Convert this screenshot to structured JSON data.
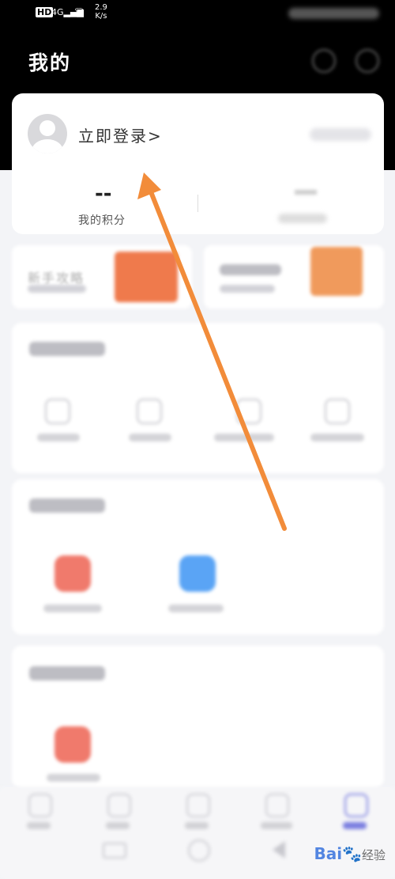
{
  "status_bar": {
    "hd": "HD",
    "signal": "4G",
    "speed_value": "2.9",
    "speed_unit": "K/s"
  },
  "header": {
    "title": "我的"
  },
  "profile": {
    "login_text": "立即登录>",
    "points_value": "--",
    "points_label": "我的积分"
  },
  "promo": {
    "guide_title": "新手攻略"
  },
  "watermark": {
    "brand": "Bai",
    "suffix": "经验"
  },
  "colors": {
    "header_bg": "#000000",
    "arrow": "#f28c3a",
    "promo_orange": "#ef7a4c",
    "service_red": "#f07a6c",
    "service_blue": "#5aa4f5",
    "nav_active": "#7b7fe0"
  }
}
